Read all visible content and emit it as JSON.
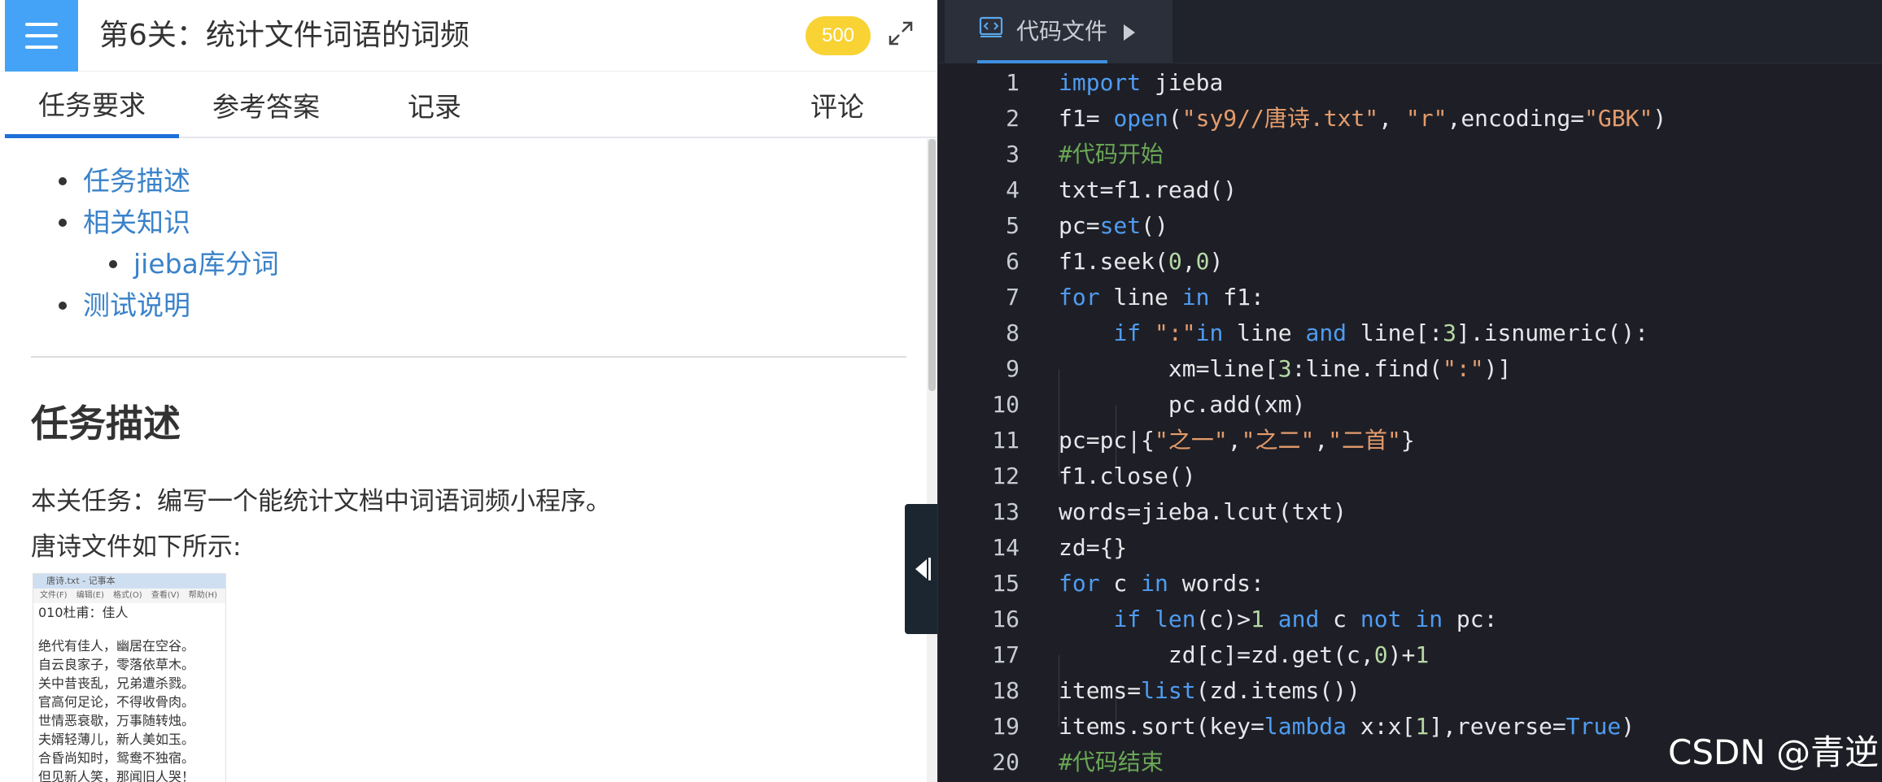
{
  "header": {
    "title": "第6关：统计文件词语的词频",
    "score": "500"
  },
  "tabs": [
    "任务要求",
    "参考答案",
    "记录",
    "评论"
  ],
  "toc": {
    "items": [
      "任务描述",
      "相关知识",
      "jieba库分词",
      "测试说明"
    ]
  },
  "task": {
    "heading": "任务描述",
    "para1": "本关任务：编写一个能统计文档中词语词频小程序。",
    "para2": "唐诗文件如下所示:"
  },
  "thumbnail": {
    "window_title": "唐诗.txt - 记事本",
    "menu": "文件(F) 编辑(E) 格式(O) 查看(V) 帮助(H)",
    "heading": "010杜甫：佳人",
    "lines": [
      "绝代有佳人，幽居在空谷。",
      "自云良家子，零落依草木。",
      "关中昔丧乱，兄弟遭杀戮。",
      "官高何足论，不得收骨肉。",
      "世情恶衰歇，万事随转烛。",
      "夫婿轻薄儿，新人美如玉。",
      "合昏尚知时，鸳鸯不独宿。",
      "但见新人笑，那闻旧人哭！"
    ]
  },
  "editor": {
    "file_tab_label": "代码文件",
    "lines": [
      {
        "n": "1",
        "t": "import jieba"
      },
      {
        "n": "2",
        "t": "f1= open(\"sy9//唐诗.txt\", \"r\",encoding=\"GBK\")"
      },
      {
        "n": "3",
        "t": "#代码开始"
      },
      {
        "n": "4",
        "t": "txt=f1.read()"
      },
      {
        "n": "5",
        "t": "pc=set()"
      },
      {
        "n": "6",
        "t": "f1.seek(0,0)"
      },
      {
        "n": "7",
        "t": "for line in f1:"
      },
      {
        "n": "8",
        "t": "    if \":\"in line and line[:3].isnumeric():"
      },
      {
        "n": "9",
        "t": "        xm=line[3:line.find(\":\")]"
      },
      {
        "n": "10",
        "t": "        pc.add(xm)"
      },
      {
        "n": "11",
        "t": "pc=pc|{\"之一\",\"之二\",\"二首\"}"
      },
      {
        "n": "12",
        "t": "f1.close()"
      },
      {
        "n": "13",
        "t": "words=jieba.lcut(txt)"
      },
      {
        "n": "14",
        "t": "zd={}"
      },
      {
        "n": "15",
        "t": "for c in words:"
      },
      {
        "n": "16",
        "t": "    if len(c)>1 and c not in pc:"
      },
      {
        "n": "17",
        "t": "        zd[c]=zd.get(c,0)+1"
      },
      {
        "n": "18",
        "t": "items=list(zd.items())"
      },
      {
        "n": "19",
        "t": "items.sort(key=lambda x:x[1],reverse=True)"
      },
      {
        "n": "20",
        "t": "#代码结束"
      }
    ]
  },
  "watermark": "CSDN @青逆",
  "colors": {
    "accent": "#45a3f7",
    "tab_underline": "#1e6fd9",
    "link": "#3a82c9",
    "badge": "#f9d234",
    "editor_bg": "#1e1f26"
  }
}
